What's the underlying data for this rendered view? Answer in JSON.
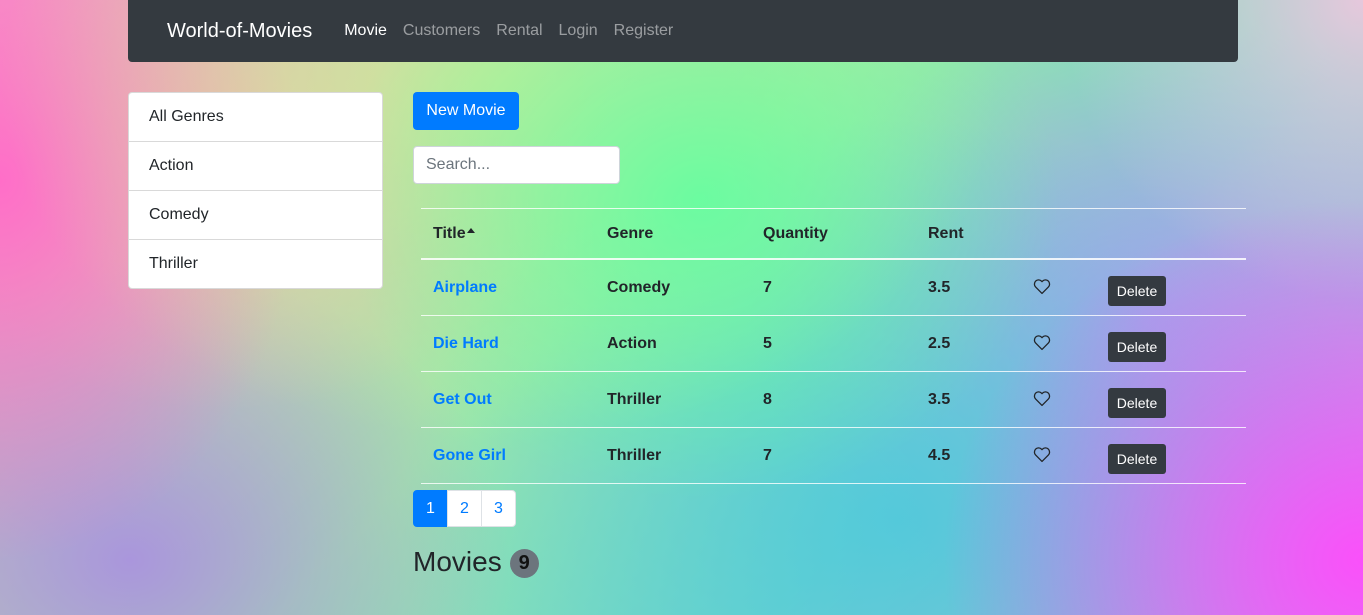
{
  "navbar": {
    "brand": "World-of-Movies",
    "links": [
      {
        "label": "Movie",
        "active": true
      },
      {
        "label": "Customers",
        "active": false
      },
      {
        "label": "Rental",
        "active": false
      },
      {
        "label": "Login",
        "active": false
      },
      {
        "label": "Register",
        "active": false
      }
    ]
  },
  "genres": [
    "All Genres",
    "Action",
    "Comedy",
    "Thriller"
  ],
  "actions": {
    "new_movie_label": "New Movie",
    "search_placeholder": "Search..."
  },
  "table": {
    "columns": [
      "Title",
      "Genre",
      "Quantity",
      "Rent"
    ],
    "sort_column": "Title",
    "sort_order": "asc",
    "like_icon": "heart-outline-icon",
    "delete_label": "Delete",
    "rows": [
      {
        "title": "Airplane",
        "genre": "Comedy",
        "quantity": "7",
        "rent": "3.5"
      },
      {
        "title": "Die Hard",
        "genre": "Action",
        "quantity": "5",
        "rent": "2.5"
      },
      {
        "title": "Get Out",
        "genre": "Thriller",
        "quantity": "8",
        "rent": "3.5"
      },
      {
        "title": "Gone Girl",
        "genre": "Thriller",
        "quantity": "7",
        "rent": "4.5"
      }
    ]
  },
  "pagination": {
    "pages": [
      "1",
      "2",
      "3"
    ],
    "active": "1"
  },
  "summary": {
    "label": "Movies",
    "count": "9"
  },
  "colors": {
    "primary": "#007bff",
    "dark": "#343a40",
    "badge": "#6c757d"
  }
}
